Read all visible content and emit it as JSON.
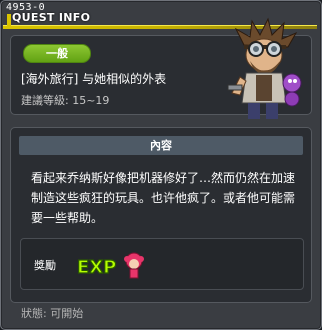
{
  "window": {
    "quest_id": "4953-0",
    "title": "QUEST INFO"
  },
  "quest": {
    "category": "一般",
    "name": "[海外旅行] 与她相似的外表",
    "level_req": "建議等級: 15~19"
  },
  "content": {
    "header": "內容",
    "description": "看起来乔纳斯好像把机器修好了…然而仍然在加速制造这些疯狂的玩具。也许他疯了。或者他可能需要一些帮助。"
  },
  "reward": {
    "label": "獎勵",
    "exp_text": "EXP"
  },
  "status": "狀態: 可開始",
  "colors": {
    "title_bar": "#d9c400",
    "badge": "#7ab624",
    "panel_bg": "#2a2d32",
    "window_bg": "#3a3d42"
  },
  "icons": {
    "npc": "npc-portrait",
    "reward": "exp-reward-icon"
  }
}
